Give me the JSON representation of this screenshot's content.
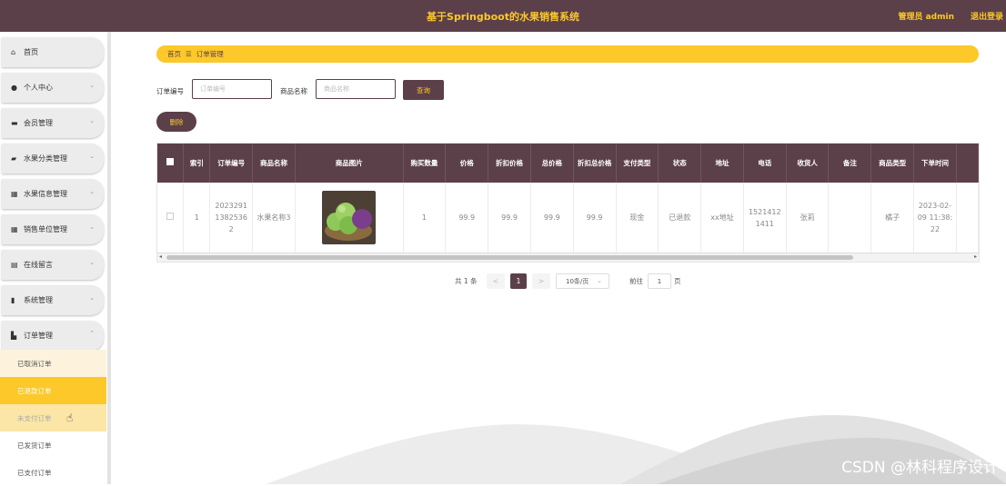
{
  "header": {
    "title": "基于Springboot的水果销售系统",
    "admin": "管理员 admin",
    "logout": "退出登录"
  },
  "sidebar": {
    "items": [
      {
        "label": "首页",
        "icon": "home-icon"
      },
      {
        "label": "个人中心",
        "icon": "user-icon"
      },
      {
        "label": "会员管理",
        "icon": "member-icon"
      },
      {
        "label": "水果分类管理",
        "icon": "category-icon"
      },
      {
        "label": "水果信息管理",
        "icon": "grid-icon"
      },
      {
        "label": "销售单位管理",
        "icon": "grid-icon"
      },
      {
        "label": "在线留言",
        "icon": "message-icon"
      },
      {
        "label": "系统管理",
        "icon": "chart-icon"
      },
      {
        "label": "订单管理",
        "icon": "order-icon"
      }
    ],
    "subitems": [
      "已取消订单",
      "已退款订单",
      "未支付订单",
      "已发货订单",
      "已支付订单"
    ]
  },
  "breadcrumb": {
    "home": "首页",
    "sep": "☰",
    "current": "订单管理"
  },
  "search": {
    "order_label": "订单编号",
    "order_placeholder": "订单编号",
    "name_label": "商品名称",
    "name_placeholder": "商品名称",
    "query": "查询"
  },
  "actions": {
    "delete": "删除"
  },
  "table": {
    "headers": [
      "",
      "索引",
      "订单编号",
      "商品名称",
      "商品图片",
      "购买数量",
      "价格",
      "折扣价格",
      "总价格",
      "折扣总价格",
      "支付类型",
      "状态",
      "地址",
      "电话",
      "收货人",
      "备注",
      "商品类型",
      "下单时间"
    ],
    "row": {
      "index": "1",
      "order_no": "20232911382536 2",
      "name": "水果名称3",
      "qty": "1",
      "price": "99.9",
      "discount_price": "99.9",
      "total": "99.9",
      "discount_total": "99.9",
      "pay_type": "现金",
      "status": "已退款",
      "address": "xx地址",
      "phone": "15214121411",
      "receiver": "张莉",
      "remark": "",
      "type": "橘子",
      "time": "2023-02-09 11:38:22"
    }
  },
  "pagination": {
    "total": "共 1 条",
    "prev": "<",
    "page": "1",
    "next": ">",
    "size": "10条/页",
    "goto": "前往",
    "goto_value": "1",
    "page_unit": "页"
  },
  "watermark": "CSDN @林科程序设计"
}
